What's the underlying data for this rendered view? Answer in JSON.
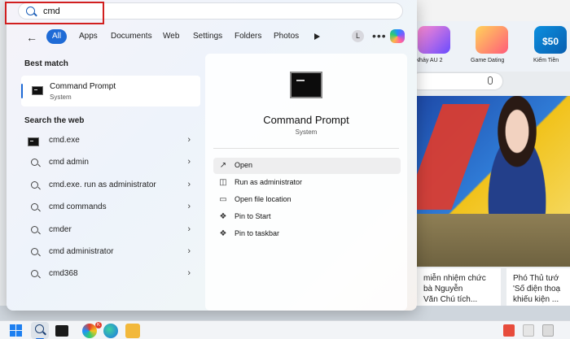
{
  "search": {
    "value": "cmd",
    "placeholder": ""
  },
  "filters": {
    "back_icon": "back-arrow-icon",
    "chips": [
      {
        "label": "All",
        "active": true
      },
      {
        "label": "Apps",
        "active": false
      },
      {
        "label": "Documents",
        "active": false
      },
      {
        "label": "Web",
        "active": false
      },
      {
        "label": "Settings",
        "active": false
      },
      {
        "label": "Folders",
        "active": false
      },
      {
        "label": "Photos",
        "active": false
      }
    ],
    "avatar_letter": "L",
    "more_label": "•••"
  },
  "best_match": {
    "heading": "Best match",
    "title": "Command Prompt",
    "subtitle": "System"
  },
  "web": {
    "heading": "Search the web",
    "items": [
      {
        "label": "cmd.exe",
        "icon": "cmd-icon"
      },
      {
        "label": "cmd admin",
        "icon": "search-icon"
      },
      {
        "label": "cmd.exe. run as administrator",
        "icon": "search-icon"
      },
      {
        "label": "cmd commands",
        "icon": "search-icon"
      },
      {
        "label": "cmder",
        "icon": "search-icon"
      },
      {
        "label": "cmd administrator",
        "icon": "search-icon"
      },
      {
        "label": "cmd368",
        "icon": "search-icon"
      }
    ]
  },
  "details": {
    "title": "Command Prompt",
    "subtitle": "System",
    "actions": [
      {
        "label": "Open",
        "icon": "open-icon"
      },
      {
        "label": "Run as administrator",
        "icon": "shield-icon"
      },
      {
        "label": "Open file location",
        "icon": "folder-icon"
      },
      {
        "label": "Pin to Start",
        "icon": "pin-icon"
      },
      {
        "label": "Pin to taskbar",
        "icon": "pin-icon"
      }
    ]
  },
  "background": {
    "games": [
      "Nhảy AU 2",
      "Game Dating",
      "Kiếm Tiền"
    ],
    "tile_texts": [
      "$50"
    ],
    "news": [
      {
        "lines": [
          "miễn nhiệm chức",
          "bà Nguyễn",
          "Văn Chú tích..."
        ]
      },
      {
        "lines": [
          "Phó Thủ tướ",
          "'Số điện thoạ",
          "khiếu kiện ..."
        ]
      }
    ]
  },
  "taskbar": {
    "badge": "K"
  },
  "colors": {
    "accent": "#1f6bd6",
    "highlight_box": "#d11f1f"
  }
}
